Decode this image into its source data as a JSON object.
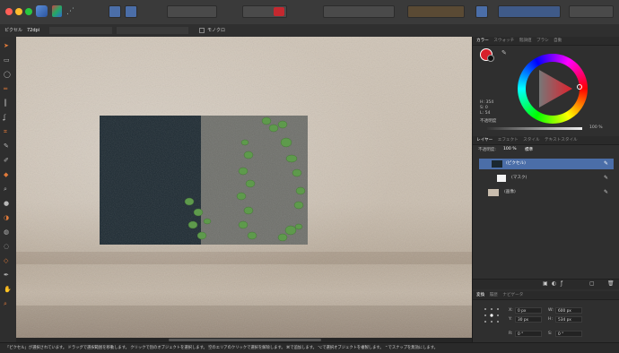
{
  "context_bar": {
    "units_label": "ピクセル",
    "dpi": "72dpi",
    "monochrome_label": "モノクロ"
  },
  "toolbar": {
    "icons": [
      "affinity-photo-icon",
      "persona-icon",
      "share-icon",
      "develop-icon",
      "export-icon",
      "selection-icon",
      "mask-icon",
      "snap-icon",
      "align-icon",
      "arrange-icon",
      "view-icon"
    ]
  },
  "tools": [
    "move-tool-icon",
    "marquee-tool-icon",
    "ellipse-marquee-icon",
    "row-marquee-icon",
    "column-marquee-icon",
    "lasso-icon",
    "crop-icon",
    "brush-icon",
    "paint-icon",
    "fill-icon",
    "zoom-icon",
    "dodge-icon",
    "burn-icon",
    "sponge-icon",
    "blur-icon",
    "sharpen-icon",
    "pen-icon",
    "hand-icon",
    "zoom-out-icon"
  ],
  "color_panel": {
    "tabs": [
      "カラー",
      "スウォッチ",
      "階調値",
      "ブラシ",
      "自動"
    ],
    "active_tab": "カラー",
    "h_label": "H: 354",
    "s_label": "S: 0",
    "l_label": "L: 54",
    "opacity_label": "不透明度",
    "opacity_value": "100 %",
    "swatch_color": "#d8202b"
  },
  "layers_panel": {
    "tabs": [
      "レイヤー",
      "エフェクト",
      "スタイル",
      "テキストスタイル"
    ],
    "active_tab": "レイヤー",
    "opacity_label": "不透明度:",
    "opacity_value": "100 %",
    "blend_mode": "標準",
    "layers": [
      {
        "name": "(ピクセル)",
        "selected": true
      },
      {
        "name": "(マスク)",
        "selected": false
      },
      {
        "name": "(画像)",
        "selected": false
      }
    ]
  },
  "transform_panel": {
    "tabs": [
      "変換",
      "履歴",
      "ナビゲータ"
    ],
    "active_tab": "変換",
    "x": "0 px",
    "y": "30 px",
    "w": "600 px",
    "h": "534 px",
    "r": "0 °",
    "s": "0 °"
  },
  "status_bar": {
    "text": "「ピクセル」が選択されています。 ドラッグで選択範囲を移動します。 クリックで別のオブジェクトを選択します。 空のエリアのクリックで選択を解除します。 ⌘で追加します。 ⌥で選択オブジェクトを複製します。 ⌃でスナップを無効にします。"
  },
  "colors": {
    "accent": "#4f76b5",
    "selection": "#4b6ea8"
  }
}
